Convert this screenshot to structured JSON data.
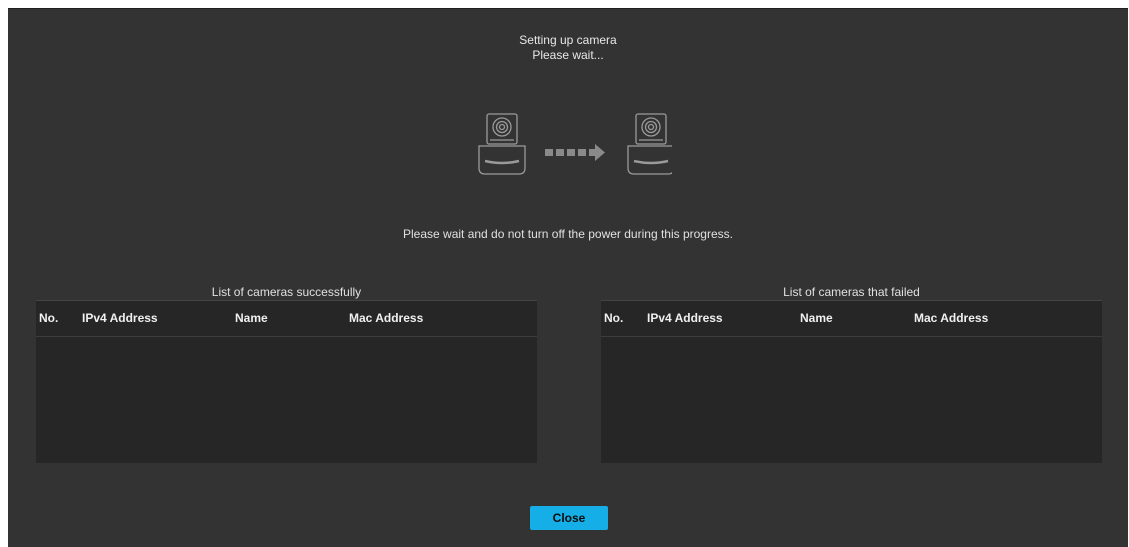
{
  "header": {
    "title": "Setting up camera",
    "subtitle": "Please wait..."
  },
  "illustration": {
    "source_icon": "ptz-camera-icon",
    "target_icon": "ptz-camera-icon",
    "transfer_icon": "dashed-arrow-icon"
  },
  "notice": "Please wait and do not turn off the power during this progress.",
  "success_panel": {
    "title": "List of cameras successfully",
    "columns": [
      "No.",
      "IPv4 Address",
      "Name",
      "Mac Address"
    ],
    "rows": []
  },
  "failed_panel": {
    "title": "List of cameras that failed",
    "columns": [
      "No.",
      "IPv4 Address",
      "Name",
      "Mac Address"
    ],
    "rows": []
  },
  "footer": {
    "close_label": "Close"
  },
  "colors": {
    "background": "#333333",
    "table_background": "#262626",
    "accent": "#15aee6"
  }
}
